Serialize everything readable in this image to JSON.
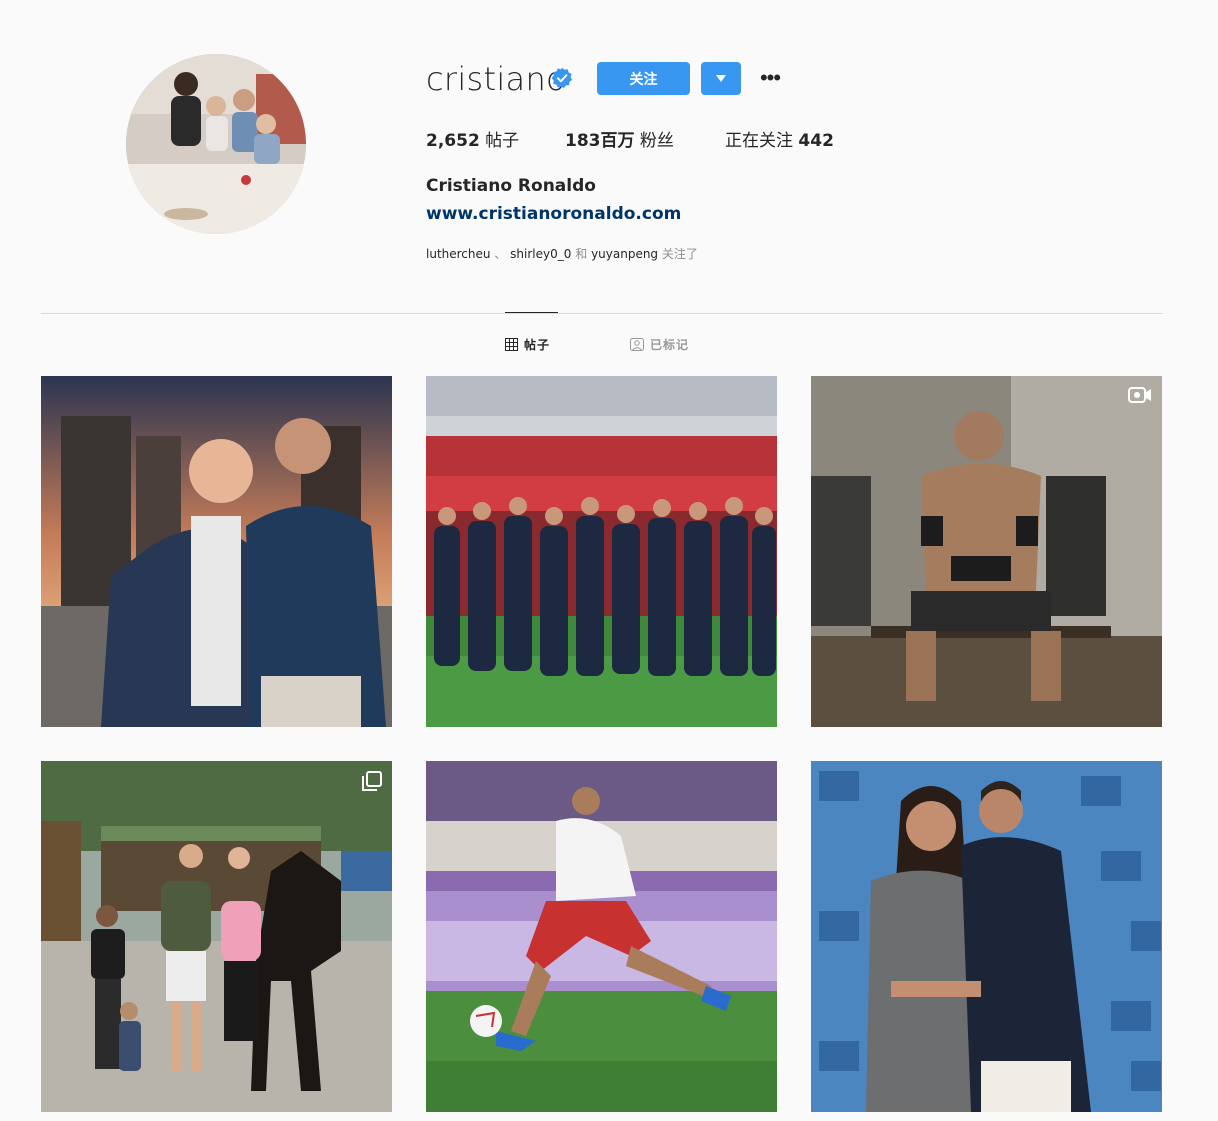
{
  "profile": {
    "username": "cristiano",
    "full_name": "Cristiano Ronaldo",
    "website": "www.cristianoronaldo.com",
    "follow_label": "关注",
    "more_label": "•••"
  },
  "stats": {
    "posts_count": "2,652",
    "posts_label": "帖子",
    "followers_count": "183百万",
    "followers_label": "粉丝",
    "following_label": "正在关注",
    "following_count": "442"
  },
  "followed_by": {
    "user1": "luthercheu",
    "sep1": "、",
    "user2": "shirley0_0",
    "and": "和",
    "user3": "yuyanpeng",
    "suffix": "关注了"
  },
  "tabs": [
    {
      "label": "帖子",
      "icon": "grid-icon",
      "active": true
    },
    {
      "label": "已标记",
      "icon": "tagged-icon",
      "active": false
    }
  ],
  "posts": [
    {
      "type": "image",
      "badge": ""
    },
    {
      "type": "image",
      "badge": ""
    },
    {
      "type": "video",
      "badge": "video-icon"
    },
    {
      "type": "carousel",
      "badge": "carousel-icon"
    },
    {
      "type": "image",
      "badge": ""
    },
    {
      "type": "image",
      "badge": ""
    }
  ],
  "colors": {
    "primary_button": "#3897f0",
    "link": "#003569",
    "verified": "#3897f0",
    "text": "#262626",
    "muted": "#8e8e8e",
    "background": "#fafafa"
  }
}
